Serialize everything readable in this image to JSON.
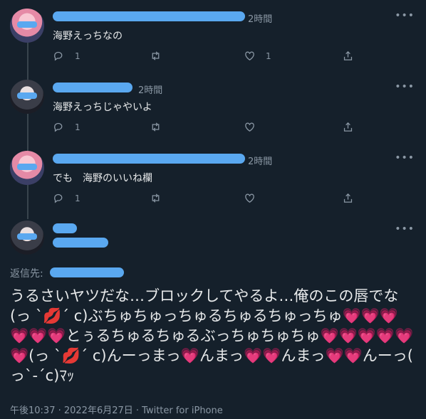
{
  "tweets": [
    {
      "time": "2時間",
      "text": "海野えっちなの",
      "replies": "1",
      "likes": "1"
    },
    {
      "time": "2時間",
      "text": "海野えっちじゃやいよ",
      "replies": "1",
      "likes": ""
    },
    {
      "time": "2時間",
      "text": "でも　海野のいいね欄",
      "replies": "1",
      "likes": ""
    }
  ],
  "main": {
    "reply_to_label": "返信先:",
    "text": "うるさいヤツだな…ブロックしてやるよ…俺のこの唇でな(っ ˋ💋ˊ c)ぶちゅちゅっちゅるちゅるちゅっちゅ💗💗💗💗💗💗とぅるちゅるちゅるぶっちゅちゅちゅ💗💗💗💗💗💗(っ ˋ💋ˊ c)んーっまっ💗んまっ💗💗んまっ💗💗んーっ( っˋ-ˊc)ﾏｯ",
    "footer": "午後10:37 · 2022年6月27日 · Twitter for iPhone"
  },
  "icons": [
    "reply-icon",
    "retweet-icon",
    "like-icon",
    "share-icon",
    "more-icon"
  ],
  "colors": {
    "background": "#15202b",
    "redaction": "#5aa8f0",
    "secondary_text": "#8b98a5"
  }
}
